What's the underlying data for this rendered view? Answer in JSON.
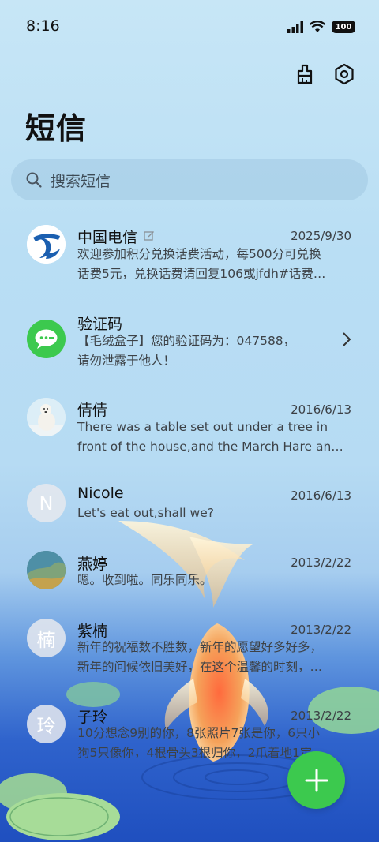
{
  "status_bar": {
    "time": "8:16",
    "battery": "100"
  },
  "top_actions": {
    "clean_icon": "broom-icon",
    "settings_icon": "hexagon-gear-icon"
  },
  "page_title": "短信",
  "search": {
    "placeholder": "搜索短信"
  },
  "conversations": [
    {
      "name": "中国电信",
      "date": "2025/9/30",
      "line1": "欢迎参加积分兑换话费活动，每500分可兑换",
      "line2": "话费5元，兑换话费请回复106或jfdh#话费…",
      "avatar": "china-telecom-logo"
    },
    {
      "name": "验证码",
      "date": "",
      "line1": "【毛绒盒子】您的验证码为：047588，",
      "line2": "请勿泄露于他人！",
      "avatar": "message-bubble-icon"
    },
    {
      "name": "倩倩",
      "date": "2016/6/13",
      "line1": "There was a table set out under a tree in",
      "line2": "front of the house,and the March Hare an…",
      "avatar": "polar-bear-photo"
    },
    {
      "name": "Nicole",
      "date": "2016/6/13",
      "line1": "Let's eat out,shall we?",
      "line2": "",
      "avatar_letter": "N"
    },
    {
      "name": "燕婷",
      "date": "2013/2/22",
      "line1": "嗯。收到啦。同乐同乐。",
      "line2": "",
      "avatar": "landscape-photo"
    },
    {
      "name": "紫楠",
      "date": "2013/2/22",
      "line1": "新年的祝福数不胜数，新年的愿望好多好多，",
      "line2": "新年的问候依旧美好，在这个温馨的时刻，…",
      "avatar_letter": "楠"
    },
    {
      "name": "子玲",
      "date": "2013/2/22",
      "line1": "10分想念9别的你，8张照片7张是你，6只小",
      "line2": "狗5只像你，4根骨头3根归你，2爪着地1定…",
      "avatar_letter": "玲"
    }
  ],
  "fab": {
    "icon": "plus-icon"
  },
  "colors": {
    "accent": "#3cc94e",
    "telecom_blue": "#1b5fb0"
  }
}
